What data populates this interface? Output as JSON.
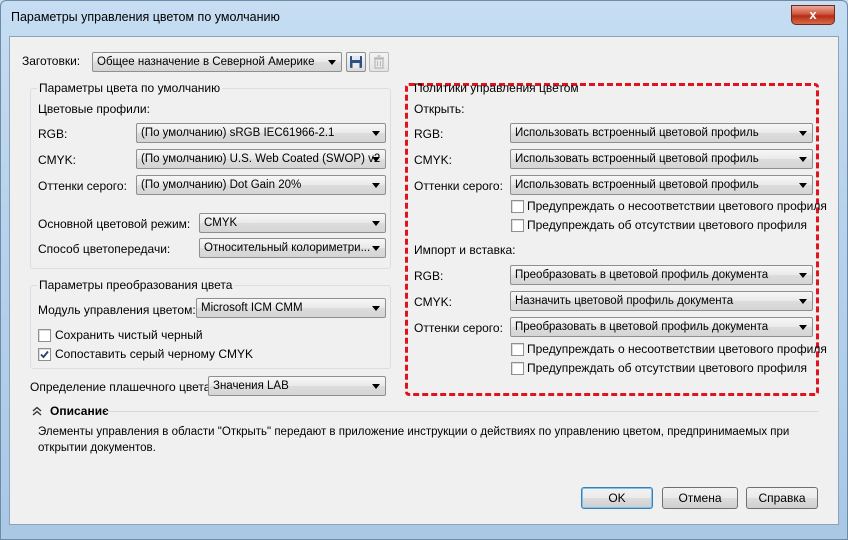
{
  "window": {
    "title": "Параметры управления цветом по умолчанию",
    "close_glyph": "x"
  },
  "presets": {
    "label": "Заготовки:",
    "value": "Общее назначение в Северной Америке"
  },
  "default_color_params": {
    "group_title": "Параметры цвета по умолчанию",
    "profiles_label": "Цветовые профили:",
    "rgb_label": "RGB:",
    "rgb_value": "(По умолчанию) sRGB IEC61966-2.1",
    "cmyk_label": "CMYK:",
    "cmyk_value": "(По умолчанию) U.S. Web Coated (SWOP) v2",
    "gray_label": "Оттенки серого:",
    "gray_value": "(По умолчанию) Dot Gain 20%",
    "mode_label": "Основной цветовой режим:",
    "mode_value": "CMYK",
    "intent_label": "Способ цветопередачи:",
    "intent_value": "Относительный колориметри..."
  },
  "conversion_params": {
    "group_title": "Параметры преобразования цвета",
    "engine_label": "Модуль управления цветом:",
    "engine_value": "Microsoft ICM CMM",
    "preserve_black_label": "Сохранить чистый черный",
    "preserve_black_checked": false,
    "map_gray_label": "Сопоставить серый черному CMYK",
    "map_gray_checked": true
  },
  "spot": {
    "label": "Определение плашечного цвета:",
    "value": "Значения LAB"
  },
  "policies": {
    "group_title": "Политики управления цветом",
    "open_label": "Открыть:",
    "open_rgb_label": "RGB:",
    "open_rgb_value": "Использовать встроенный цветовой профиль",
    "open_cmyk_label": "CMYK:",
    "open_cmyk_value": "Использовать встроенный цветовой профиль",
    "open_gray_label": "Оттенки серого:",
    "open_gray_value": "Использовать встроенный цветовой профиль",
    "open_warn_mismatch": "Предупреждать о несоответствии цветового профиля",
    "open_warn_missing": "Предупреждать об отсутствии цветового профиля",
    "import_label": "Импорт и вставка:",
    "import_rgb_label": "RGB:",
    "import_rgb_value": "Преобразовать в цветовой профиль документа",
    "import_cmyk_label": "CMYK:",
    "import_cmyk_value": "Назначить цветовой профиль документа",
    "import_gray_label": "Оттенки серого:",
    "import_gray_value": "Преобразовать в цветовой профиль документа",
    "import_warn_mismatch": "Предупреждать о несоответствии цветового профиля",
    "import_warn_missing": "Предупреждать об отсутствии цветового профиля"
  },
  "description": {
    "title": "Описание",
    "text": "Элементы управления в области \"Открыть\" передают в приложение инструкции о действиях по управлению цветом, предпринимаемых при открытии документов."
  },
  "buttons": {
    "ok": "OK",
    "cancel": "Отмена",
    "help": "Справка"
  },
  "colors": {
    "highlight_dash": "#e0141e",
    "default_button_border": "#3c7fb1"
  }
}
